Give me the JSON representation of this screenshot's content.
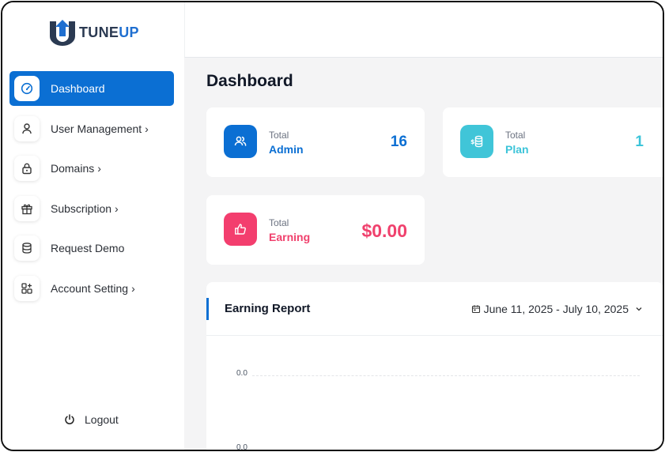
{
  "brand": {
    "logo_prefix": "T",
    "logo_text_main": "TUNE",
    "logo_text_accent": "UP"
  },
  "sidebar": {
    "items": [
      {
        "label": "Dashboard",
        "icon": "dashboard-gauge-icon",
        "chevron": ""
      },
      {
        "label": "User Management",
        "icon": "user-icon",
        "chevron": "›"
      },
      {
        "label": "Domains",
        "icon": "lock-icon",
        "chevron": "›"
      },
      {
        "label": "Subscription",
        "icon": "gift-icon",
        "chevron": "›"
      },
      {
        "label": "Request Demo",
        "icon": "database-icon",
        "chevron": ""
      },
      {
        "label": "Account Setting",
        "icon": "grid-plus-icon",
        "chevron": "›"
      }
    ],
    "logout_label": "Logout"
  },
  "main": {
    "title": "Dashboard",
    "stats": [
      {
        "small": "Total",
        "name": "Admin",
        "value": "16",
        "color": "#0b6fd3",
        "badge_color": "#0b6fd3",
        "icon": "users-icon"
      },
      {
        "small": "Total",
        "name": "Plan",
        "value": "1",
        "color": "#3cc4d9",
        "badge_color": "#40c5d8",
        "icon": "dollar-coins-icon"
      },
      {
        "small": "Total",
        "name": "Earning",
        "value": "$0.00",
        "color": "#f0416d",
        "badge_color": "#f33e6e",
        "icon": "thumbs-up-icon"
      }
    ],
    "report": {
      "title": "Earning Report",
      "date_range": "June 11, 2025 - July 10, 2025",
      "ticks": [
        "0.0",
        "0.0"
      ]
    }
  },
  "colors": {
    "accent": "#0b6fd3",
    "active_text": "#ffffff"
  }
}
